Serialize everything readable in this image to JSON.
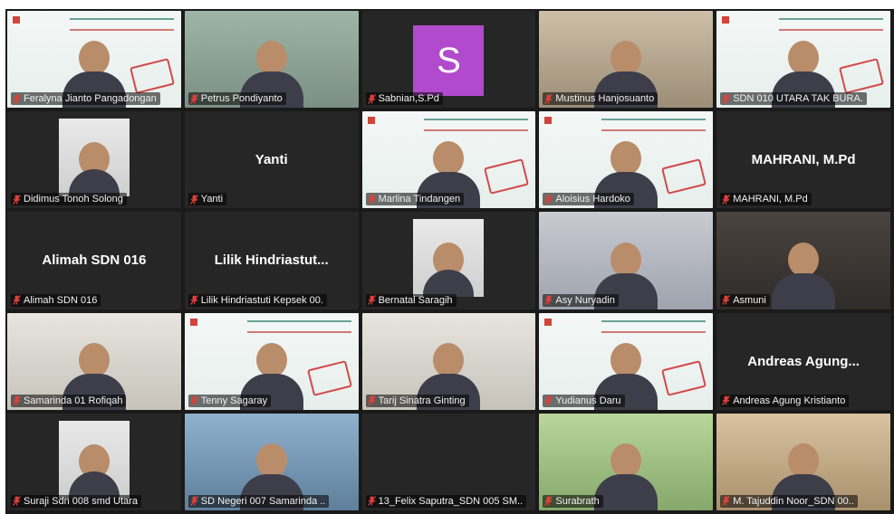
{
  "participants": [
    {
      "name": "Feralyna Jianto Pangadongan",
      "display": null,
      "active": true,
      "bg": "slide"
    },
    {
      "name": "Petrus Pondiyanto",
      "display": null,
      "active": false,
      "bg": "room1"
    },
    {
      "name": "Sabnian,S.Pd",
      "display": null,
      "active": false,
      "bg": "black",
      "avatar_letter": "S",
      "avatar_color": "#b24acd"
    },
    {
      "name": "Mustinus Hanjosuanto",
      "display": null,
      "active": false,
      "bg": "room2"
    },
    {
      "name": "SDN 010 UTARA TAK BURA.",
      "display": null,
      "active": false,
      "bg": "slide"
    },
    {
      "name": "Didimus Tonoh Solong",
      "display": null,
      "active": false,
      "bg": "black",
      "inset": true
    },
    {
      "name": "Yanti",
      "display": "Yanti",
      "active": false,
      "bg": "black"
    },
    {
      "name": "Marlina Tindangen",
      "display": null,
      "active": false,
      "bg": "slide"
    },
    {
      "name": "Aloisius Hardoko",
      "display": null,
      "active": false,
      "bg": "slide"
    },
    {
      "name": "MAHRANI, M.Pd",
      "display": "MAHRANI, M.Pd",
      "active": false,
      "bg": "black"
    },
    {
      "name": "Alimah SDN 016",
      "display": "Alimah SDN 016",
      "active": false,
      "bg": "black"
    },
    {
      "name": "Lilik Hindriastuti Kepsek 00.",
      "display": "Lilik  Hindriastut...",
      "active": false,
      "bg": "black"
    },
    {
      "name": "Bernatal Saragih",
      "display": null,
      "active": false,
      "bg": "black",
      "inset": true
    },
    {
      "name": "Asy Nuryadin",
      "display": null,
      "active": false,
      "bg": "room3"
    },
    {
      "name": "Asmuni",
      "display": null,
      "active": false,
      "bg": "dark"
    },
    {
      "name": "Samarinda 01 Rofiqah",
      "display": null,
      "active": false,
      "bg": "room4"
    },
    {
      "name": "Tenny Sagaray",
      "display": null,
      "active": false,
      "bg": "slide"
    },
    {
      "name": "Tarij Sinatra Ginting",
      "display": null,
      "active": false,
      "bg": "room4"
    },
    {
      "name": "Yudianus Daru",
      "display": null,
      "active": false,
      "bg": "slide"
    },
    {
      "name": "Andreas Agung Kristianto",
      "display": "Andreas  Agung...",
      "active": false,
      "bg": "black"
    },
    {
      "name": "Suraji Sdn 008 smd Utara",
      "display": null,
      "active": false,
      "bg": "black",
      "inset": true
    },
    {
      "name": "SD Negeri 007 Samarinda ..",
      "display": null,
      "active": false,
      "bg": "blue"
    },
    {
      "name": "13_Felix Saputra_SDN 005 SM..",
      "display": null,
      "active": false,
      "bg": "black"
    },
    {
      "name": "Surabrath",
      "display": null,
      "active": false,
      "bg": "green"
    },
    {
      "name": "M. Tajuddin Noor_SDN 00..",
      "display": null,
      "active": false,
      "bg": "warm"
    }
  ],
  "colors": {
    "active_border": "#d7f36a",
    "mute_icon": "#e0403a",
    "grid_bg": "#1a1a1a"
  },
  "icons": {
    "muted": "microphone-muted-icon"
  }
}
